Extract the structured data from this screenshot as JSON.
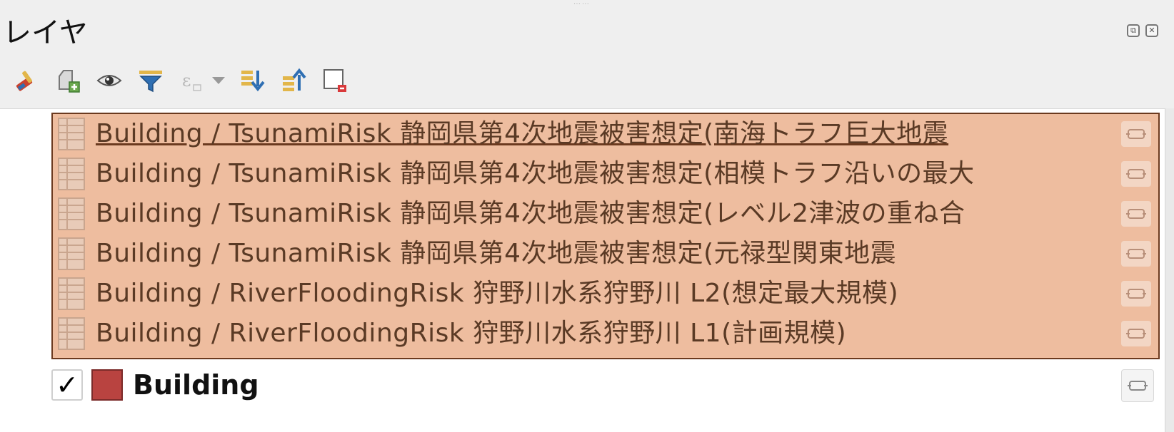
{
  "panel": {
    "title": "レイヤ",
    "title_buttons": [
      {
        "icon": "float-icon",
        "glyph": "⧉"
      },
      {
        "icon": "close-icon",
        "glyph": "✕"
      }
    ]
  },
  "toolbar": {
    "items": [
      {
        "icon": "style-brush-icon"
      },
      {
        "icon": "add-group-icon"
      },
      {
        "icon": "visibility-eye-icon"
      },
      {
        "icon": "filter-legend-icon"
      },
      {
        "icon": "filter-expression-icon",
        "disabled": true
      },
      {
        "icon": "expand-all-icon"
      },
      {
        "icon": "collapse-all-icon"
      },
      {
        "icon": "remove-layer-icon"
      }
    ]
  },
  "layers": {
    "group_items": [
      {
        "label": "Building / TsunamiRisk 静岡県第4次地震被害想定(南海トラフ巨大地震",
        "current": true
      },
      {
        "label": "Building / TsunamiRisk 静岡県第4次地震被害想定(相模トラフ沿いの最大"
      },
      {
        "label": "Building / TsunamiRisk 静岡県第4次地震被害想定(レベル2津波の重ね合"
      },
      {
        "label": "Building / TsunamiRisk 静岡県第4次地震被害想定(元禄型関東地震"
      },
      {
        "label": "Building / RiverFloodingRisk 狩野川水系狩野川 L2(想定最大規模)"
      },
      {
        "label": "Building / RiverFloodingRisk 狩野川水系狩野川 L1(計画規模)"
      }
    ],
    "building": {
      "label": "Building",
      "checked": true,
      "check_glyph": "✓",
      "swatch_color": "#b94340"
    }
  },
  "colors": {
    "selection_fill": "#eebd9f",
    "selection_border": "#6b3a1f",
    "selected_text": "#5a3a25"
  }
}
